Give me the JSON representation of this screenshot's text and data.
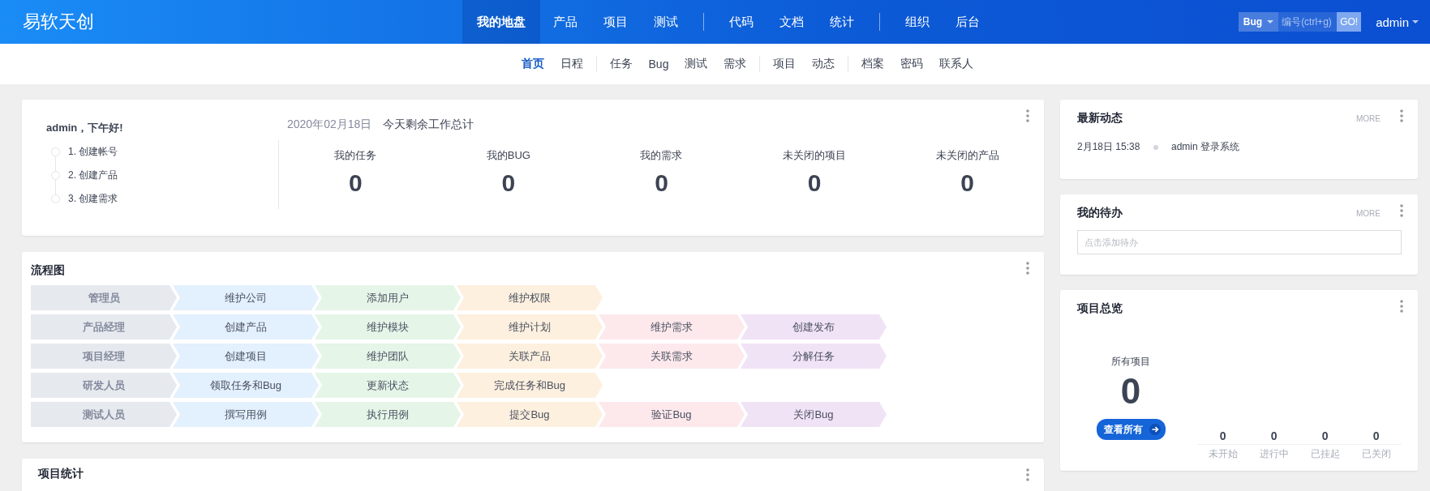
{
  "header": {
    "logo": "易软天创",
    "nav_groups": [
      [
        {
          "label": "我的地盘",
          "selected": true
        },
        {
          "label": "产品",
          "selected": false
        },
        {
          "label": "项目",
          "selected": false
        },
        {
          "label": "测试",
          "selected": false
        }
      ],
      [
        {
          "label": "代码",
          "selected": false
        },
        {
          "label": "文档",
          "selected": false
        },
        {
          "label": "统计",
          "selected": false
        }
      ],
      [
        {
          "label": "组织",
          "selected": false
        },
        {
          "label": "后台",
          "selected": false
        }
      ]
    ],
    "search": {
      "type": "Bug",
      "placeholder": "编号(ctrl+g)",
      "button": "GO!"
    },
    "user": "admin"
  },
  "subnav_groups": [
    [
      {
        "label": "首页",
        "selected": true
      },
      {
        "label": "日程",
        "selected": false
      }
    ],
    [
      {
        "label": "任务",
        "selected": false
      },
      {
        "label": "Bug",
        "selected": false
      },
      {
        "label": "测试",
        "selected": false
      },
      {
        "label": "需求",
        "selected": false
      }
    ],
    [
      {
        "label": "项目",
        "selected": false
      },
      {
        "label": "动态",
        "selected": false
      }
    ],
    [
      {
        "label": "档案",
        "selected": false
      },
      {
        "label": "密码",
        "selected": false
      },
      {
        "label": "联系人",
        "selected": false
      }
    ]
  ],
  "welcome": {
    "greeting": "admin，下午好!",
    "steps": [
      "1. 创建帐号",
      "2. 创建产品",
      "3. 创建需求"
    ],
    "date": "2020年02月18日",
    "summary_title": "今天剩余工作总计",
    "stats": [
      {
        "label": "我的任务",
        "value": "0"
      },
      {
        "label": "我的BUG",
        "value": "0"
      },
      {
        "label": "我的需求",
        "value": "0"
      },
      {
        "label": "未关闭的项目",
        "value": "0"
      },
      {
        "label": "未关闭的产品",
        "value": "0"
      }
    ]
  },
  "flowchart": {
    "title": "流程图",
    "rows": [
      {
        "role": "管理员",
        "steps": [
          "维护公司",
          "添加用户",
          "维护权限"
        ]
      },
      {
        "role": "产品经理",
        "steps": [
          "创建产品",
          "维护模块",
          "维护计划",
          "维护需求",
          "创建发布"
        ]
      },
      {
        "role": "项目经理",
        "steps": [
          "创建项目",
          "维护团队",
          "关联产品",
          "关联需求",
          "分解任务"
        ]
      },
      {
        "role": "研发人员",
        "steps": [
          "领取任务和Bug",
          "更新状态",
          "完成任务和Bug"
        ]
      },
      {
        "role": "测试人员",
        "steps": [
          "撰写用例",
          "执行用例",
          "提交Bug",
          "验证Bug",
          "关闭Bug"
        ]
      }
    ]
  },
  "project_stats": {
    "title": "项目统计"
  },
  "dynamics": {
    "title": "最新动态",
    "more": "MORE",
    "items": [
      {
        "time": "2月18日 15:38",
        "text": "admin 登录系统"
      }
    ]
  },
  "todo": {
    "title": "我的待办",
    "more": "MORE",
    "placeholder": "点击添加待办"
  },
  "overview": {
    "title": "项目总览",
    "all_label": "所有项目",
    "all_value": "0",
    "button": "查看所有",
    "counts": [
      {
        "value": "0",
        "label": "未开始"
      },
      {
        "value": "0",
        "label": "进行中"
      },
      {
        "value": "0",
        "label": "已挂起"
      },
      {
        "value": "0",
        "label": "已关闭"
      }
    ]
  }
}
